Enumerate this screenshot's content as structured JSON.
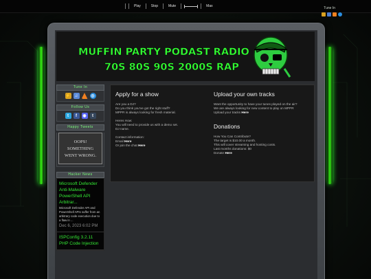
{
  "player": {
    "play": "Play",
    "stop": "Stop",
    "mute": "Mute",
    "max": "Max"
  },
  "tune_in_top": "Tune In",
  "banner": {
    "line1": "MUFFIN PARTY PODAST RADIO",
    "line2": "70S 80S 90S 2000S RAP"
  },
  "sidebar": {
    "tune_in_title": "Tune In",
    "follow_us_title": "Follow Us",
    "tweets_title": "Happy Tweets",
    "oops_line1": "OOPS!",
    "oops_line2": "SOMETHING",
    "oops_line3": "WENT WRONG.",
    "news_title": "Hacker News",
    "news": [
      {
        "title": "Microsoft Defender Anti-Malware PowerShell API Arbitrar...",
        "body": "Microsoft Defender API and PowerShell APIs suffer from an arbitrary code execution due to a flaw in ...",
        "date": "Dec 6, 2023 6:02 PM"
      },
      {
        "title": "ISPConfig 3.2.11 PHP Code Injection",
        "body": "",
        "date": ""
      }
    ]
  },
  "apply": {
    "heading": "Apply for a show",
    "p1": "Are you a DJ?\nDo you think you've got the right stuff?\nMPPR is always looking for fresh material.",
    "p2": "Heres How:\nYou will need to provide us with a demo set.\nDJ name.",
    "p3_intro": "Contact information:",
    "email_label": "Email",
    "email_link": "Here",
    "chat_label": "Or join the chat",
    "chat_link": "Here"
  },
  "upload": {
    "heading": "Upload your own tracks",
    "p1": "Want the opportunity to have your tunes played on the air?\nWe are always looking for new content to play on MPPR",
    "upload_label": "Upload your tracks",
    "upload_link": "Here"
  },
  "donations": {
    "heading": "Donations",
    "p1": "How You Can Contribute?\nThe target is $10.00 a month.\nThis will cover streaming and hosting costs.\nLast months donations: $0",
    "donate_label": "Donate",
    "donate_link": "Here"
  },
  "colors": {
    "accent": "#33ff33",
    "background": "#0a0d0a"
  }
}
